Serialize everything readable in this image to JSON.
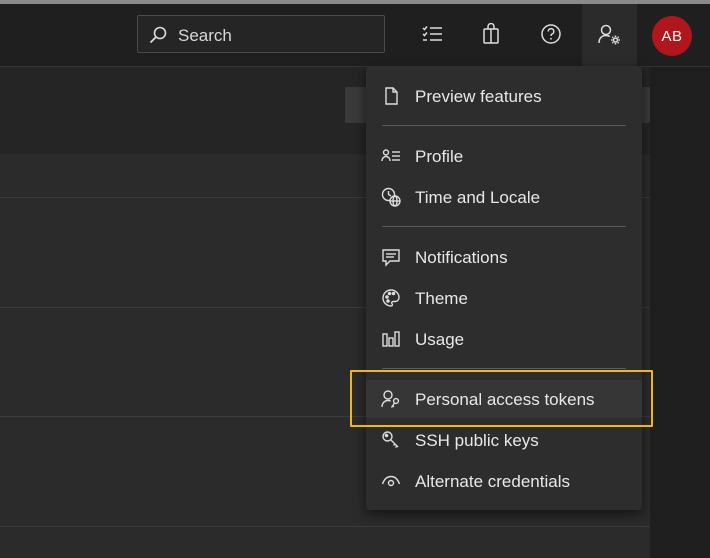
{
  "topbar": {
    "search_placeholder": "Search",
    "icons": [
      "search-icon",
      "list-icon",
      "shopping-bag-icon",
      "help-icon",
      "user-settings-icon"
    ],
    "avatar_initials": "AB",
    "avatar_color": "#b0161b"
  },
  "menu": {
    "items": [
      {
        "label": "Preview features",
        "icon": "document-icon"
      },
      {
        "label": "Profile",
        "icon": "contact-card-icon"
      },
      {
        "label": "Time and Locale",
        "icon": "clock-globe-icon"
      },
      {
        "label": "Notifications",
        "icon": "message-icon"
      },
      {
        "label": "Theme",
        "icon": "palette-icon"
      },
      {
        "label": "Usage",
        "icon": "bar-chart-icon"
      },
      {
        "label": "Personal access tokens",
        "icon": "user-key-icon"
      },
      {
        "label": "SSH public keys",
        "icon": "ssh-key-icon"
      },
      {
        "label": "Alternate credentials",
        "icon": "eye-icon"
      }
    ],
    "highlighted_item": "Personal access tokens",
    "highlight_color": "#f2b61d"
  }
}
